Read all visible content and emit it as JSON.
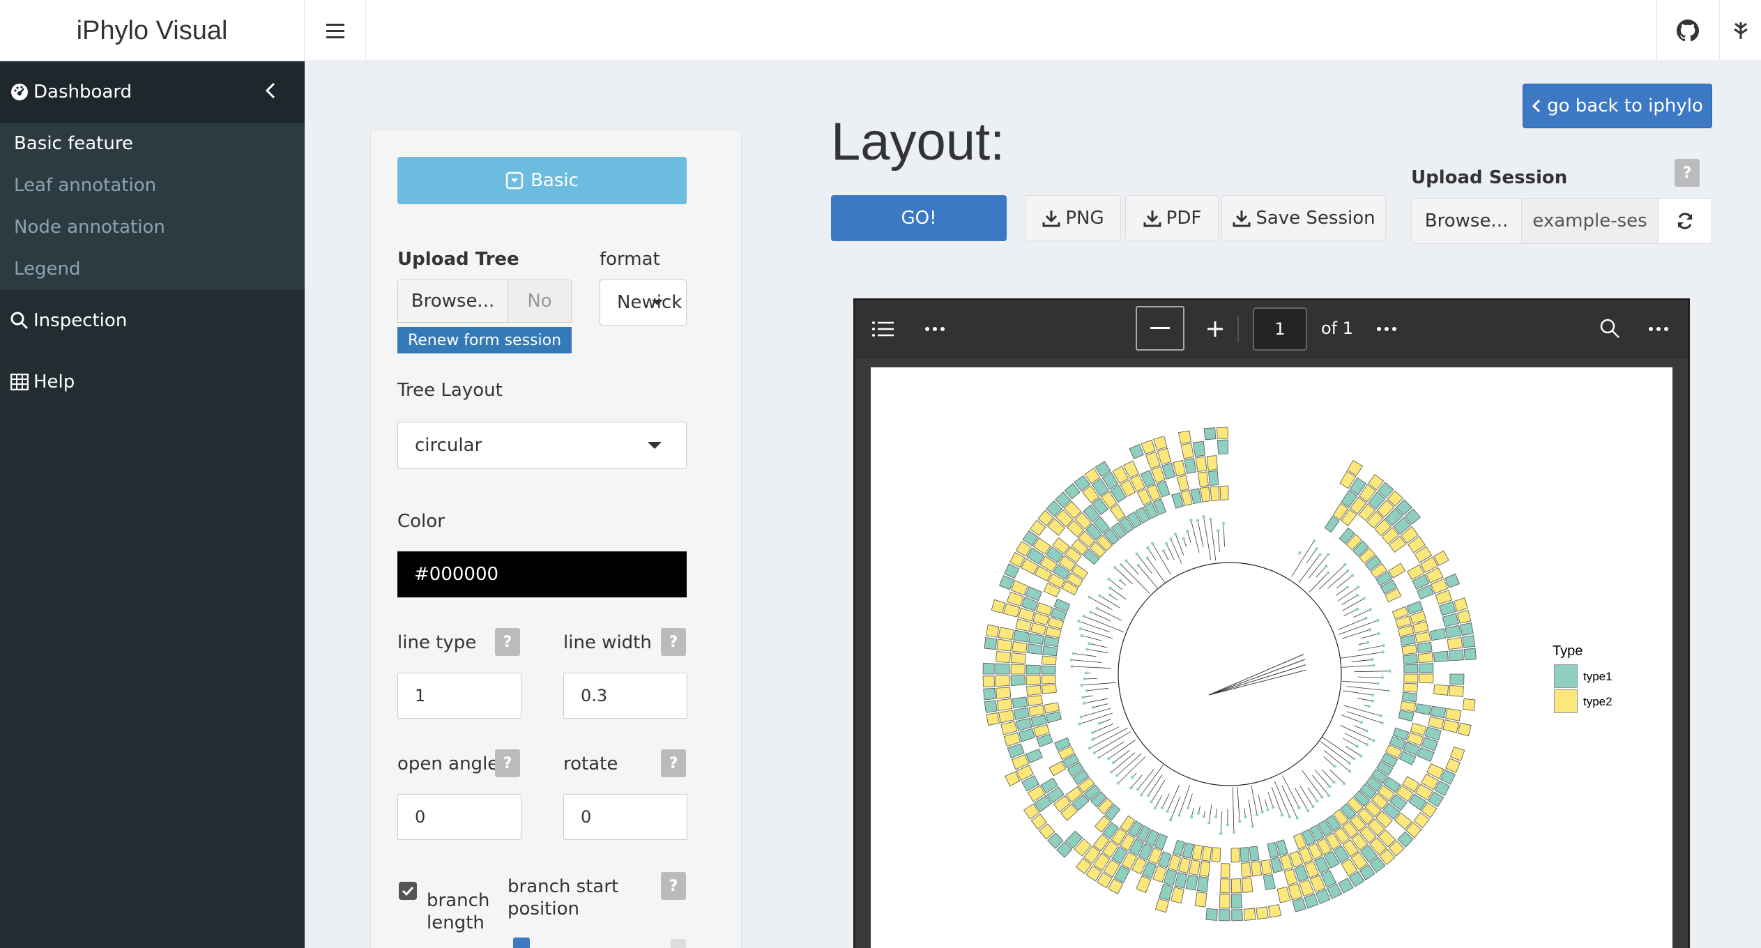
{
  "header": {
    "brand": "iPhylo Visual"
  },
  "sidebar": {
    "dashboard": "Dashboard",
    "submenu": [
      "Basic feature",
      "Leaf annotation",
      "Node annotation",
      "Legend"
    ],
    "inspection": "Inspection",
    "help": "Help"
  },
  "panel": {
    "basic_button": "Basic",
    "upload_tree_label": "Upload  Tree",
    "browse_label": "Browse...",
    "file_name": "No",
    "renew_label": "Renew form session",
    "format_label": "format",
    "format_value": "Newick",
    "tree_layout_label": "Tree  Layout",
    "tree_layout_value": "circular",
    "color_label": "Color",
    "color_value": "#000000",
    "line_type_label": "line  type",
    "line_type_value": "1",
    "line_width_label": "line  width",
    "line_width_value": "0.3",
    "open_angle_label": "open  angle",
    "open_angle_value": "0",
    "rotate_label": "rotate",
    "rotate_value": "0",
    "branch_length_label_1": "branch",
    "branch_length_label_2": "length",
    "branch_start_label_1": "branch  start",
    "branch_start_label_2": "position",
    "help_mark": "?"
  },
  "main": {
    "title": "Layout:",
    "go_back": "go back to iphylo",
    "go": "GO!",
    "png": "PNG",
    "pdf": "PDF",
    "save_session": "Save Session",
    "upload_session_label": "Upload  Session",
    "session_browse": "Browse...",
    "session_file": "example-ses",
    "help_mark": "?"
  },
  "pdf_viewer": {
    "page_number": "1",
    "page_total": "of 1"
  },
  "figure": {
    "legend_title": "Type",
    "legend_items": [
      {
        "label": "type1",
        "color": "#8ecfc0"
      },
      {
        "label": "type2",
        "color": "#fbe77a"
      }
    ]
  }
}
